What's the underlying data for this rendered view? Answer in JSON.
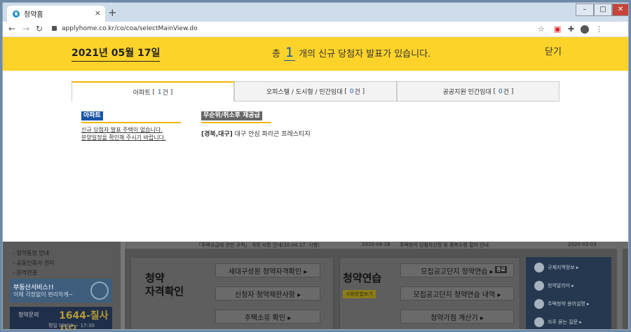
{
  "browser": {
    "tab_title": "청약홈",
    "tab_close": "×",
    "new_tab": "+",
    "min": "–",
    "max": "□",
    "close": "✕",
    "url": "applyhome.co.kr/co/coa/selectMainView.do"
  },
  "banner": {
    "date": "2021년 05월 17일",
    "msg_prefix": "총",
    "count": "1",
    "msg_suffix": "개의 신규 당첨자 발표가 있습니다.",
    "close": "닫기"
  },
  "tabs": [
    {
      "name": "아파트",
      "count": "1",
      "suffix": "건"
    },
    {
      "name": "오피스텔 / 도시형 / 민간임대",
      "count": "0",
      "suffix": "건"
    },
    {
      "name": "공공지원 민간임대",
      "count": "0",
      "suffix": "건"
    }
  ],
  "apartment": {
    "title": "아파트",
    "notice_line1": "신규 당첨자 발표 주택이 없습니다.",
    "notice_line2": "분양일정을 확인해 주시기 바랍니다."
  },
  "lottery": {
    "title": "무순위/취소후 재공급",
    "region": "[경북,대구]",
    "name": "대구 안심 파라곤 프레스티지"
  },
  "background": {
    "news1": "「주택공급에 관한 규칙」 개정 사항 안내(20.04.17. 시행)",
    "news1_date": "2020-04-16",
    "news2": "주택청약 당첨자산정 및 중복수령 절차 안내",
    "news2_date": "2020-03-03",
    "side_items": [
      "- 청약통장 안내",
      "- 공동인증서 관리",
      "- 원격연결"
    ],
    "promo_t1": "부동산서비스!!",
    "promo_t2": "이제 걱정없이 편리하게~",
    "call_t1": "청약문의",
    "call_t2": "1644-칠사사오",
    "call_t3": "평일 09:00 ~ 17:30",
    "card1_title": "청약\n자격확인",
    "card1_btns": [
      "세대구성원 청약자격확인 ▸",
      "신청자 청약제한사항 ▸",
      "주택소유 확인 ▸"
    ],
    "card2_title": "청약연습",
    "card2_badge": "사용방법보기",
    "card2_tag": "종료",
    "card2_btns": [
      "모집공고단지 청약연습 ▸",
      "모집공고단지 청약연습 내역 ▸",
      "청약가점 계산기 ▸"
    ],
    "right_items": [
      "규제지역정보 ▸",
      "청약알리미 ▸",
      "주택청약 용어설명 ▸",
      "자주 묻는 질문 ▸"
    ]
  }
}
